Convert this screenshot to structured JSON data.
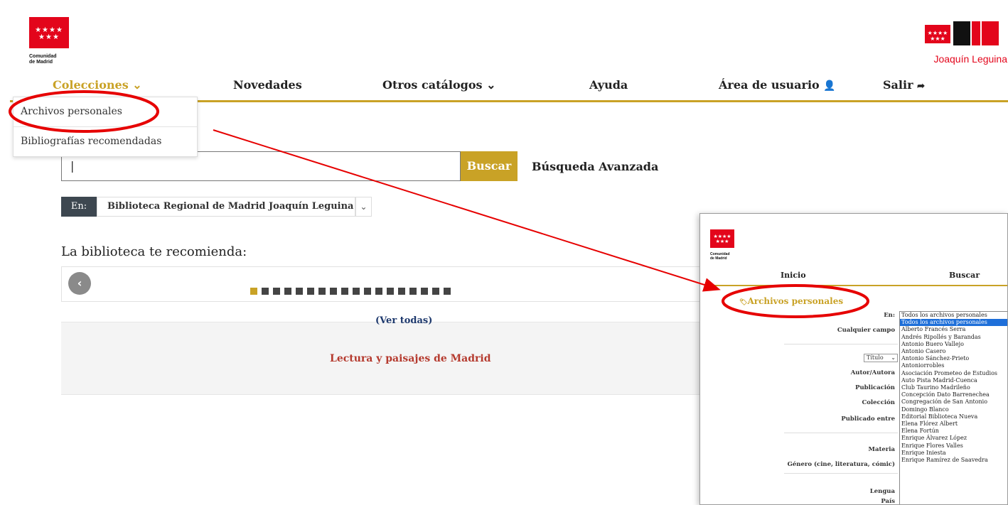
{
  "header": {
    "cm_logo": {
      "line1": "Comunidad",
      "line2": "de Madrid",
      "stars": "★★★★ ★★★"
    },
    "br_logo": {
      "text": "Joaquín Leguina",
      "stars": "★★★★ ★★★"
    }
  },
  "nav": {
    "colecciones": "Colecciones",
    "novedades": "Novedades",
    "otros": "Otros catálogos",
    "ayuda": "Ayuda",
    "area": "Área de usuario",
    "salir": "Salir",
    "caret": "⌄",
    "user_icon": "👤",
    "exit_icon": "➦"
  },
  "dropdown": {
    "items": [
      "Archivos personales",
      "Bibliografías recomendadas"
    ]
  },
  "search": {
    "value": "|",
    "button": "Buscar",
    "advanced": "Búsqueda Avanzada"
  },
  "scope": {
    "label": "En:",
    "value": "Biblioteca Regional de Madrid Joaquín Leguina",
    "caret": "⌄"
  },
  "recommend": {
    "title": "La biblioteca te recomienda:",
    "prev_icon": "‹",
    "dots_total": 18,
    "dots_active": 1,
    "view_all": "(Ver todas)",
    "item": "Lectura y paisajes de Madrid"
  },
  "inset": {
    "logo_line1": "Comunidad",
    "logo_line2": "de Madrid",
    "logo_stars": "★★★★ ★★★",
    "nav": [
      "Inicio",
      "Buscar"
    ],
    "section": "Archivos personales",
    "section_icon": "🏷",
    "labels": {
      "en": "En:",
      "any": "Cualquier campo",
      "autor": "Autor/Autora",
      "publicacion": "Publicación",
      "coleccion": "Colección",
      "publicado": "Publicado entre",
      "materia": "Materia",
      "genero": "Género (cine, literatura, cómic)",
      "lengua": "Lengua",
      "pais": "País"
    },
    "titulo_select": "Título",
    "lengua_select": "—",
    "pais_select": "——",
    "list": [
      "Todos los archivos personales",
      "Todos los archivos personales",
      "Alberto Francés Serra",
      "Andrés Ripollés y Barandas",
      "Antonio Buero Vallejo",
      "Antonio Casero",
      "Antonio Sánchez-Prieto",
      "Antoniorrobles",
      "Asociación Prometeo de Estudios",
      "Auto Pista Madrid-Cuenca",
      "Club Taurino Madrileño",
      "Concepción Dato Barrenechea",
      "Congregación de San Antonio",
      "Domingo Blanco",
      "Editorial Biblioteca Nueva",
      "Elena Flórez Albert",
      "Elena Fortún",
      "Enrique Álvarez López",
      "Enrique Flores Valles",
      "Enrique Iniesta",
      "Enrique Ramírez de Saavedra"
    ]
  }
}
